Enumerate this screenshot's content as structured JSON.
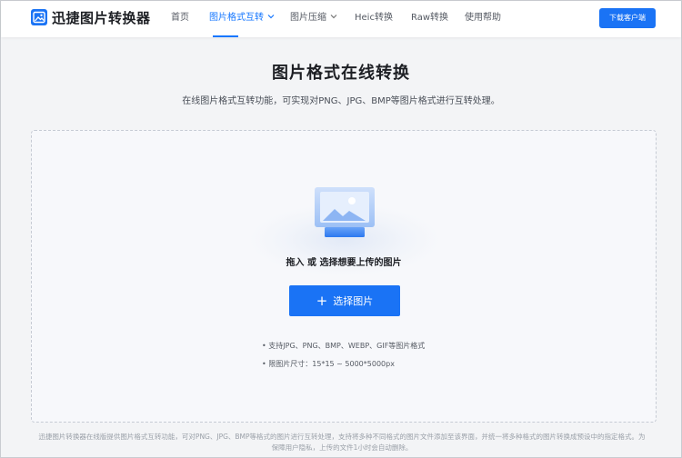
{
  "header": {
    "brand": "迅捷图片转换器",
    "nav": [
      {
        "label": "首页"
      },
      {
        "label": "图片格式互转"
      },
      {
        "label": "图片压缩"
      },
      {
        "label": "Heic转换"
      },
      {
        "label": "Raw转换"
      },
      {
        "label": "使用帮助"
      }
    ],
    "active_index": 1,
    "download_label": "下载客户端"
  },
  "main": {
    "title": "图片格式在线转换",
    "subtitle": "在线图片格式互转功能，可实现对PNG、JPG、BMP等图片格式进行互转处理。",
    "upload": {
      "hint": "拖入 或 选择想要上传的图片",
      "button_label": "选择图片",
      "notes": [
        "• 支持JPG、PNG、BMP、WEBP、GIF等图片格式",
        "• 限图片尺寸：15*15 ~ 5000*5000px"
      ]
    }
  },
  "footer": {
    "text": "迅捷图片转换器在线版提供图片格式互转功能，可对PNG、JPG、BMP等格式的图片进行互转处理，支持将多种不同格式的图片文件添加至该界面，并统一将多种格式的图片转换成预设中的指定格式。为保障用户隐私，上传的文件1小时会自动删除。"
  },
  "colors": {
    "accent": "#1677ff",
    "button": "#1a73f5",
    "page_bg": "#f3f4f6"
  }
}
